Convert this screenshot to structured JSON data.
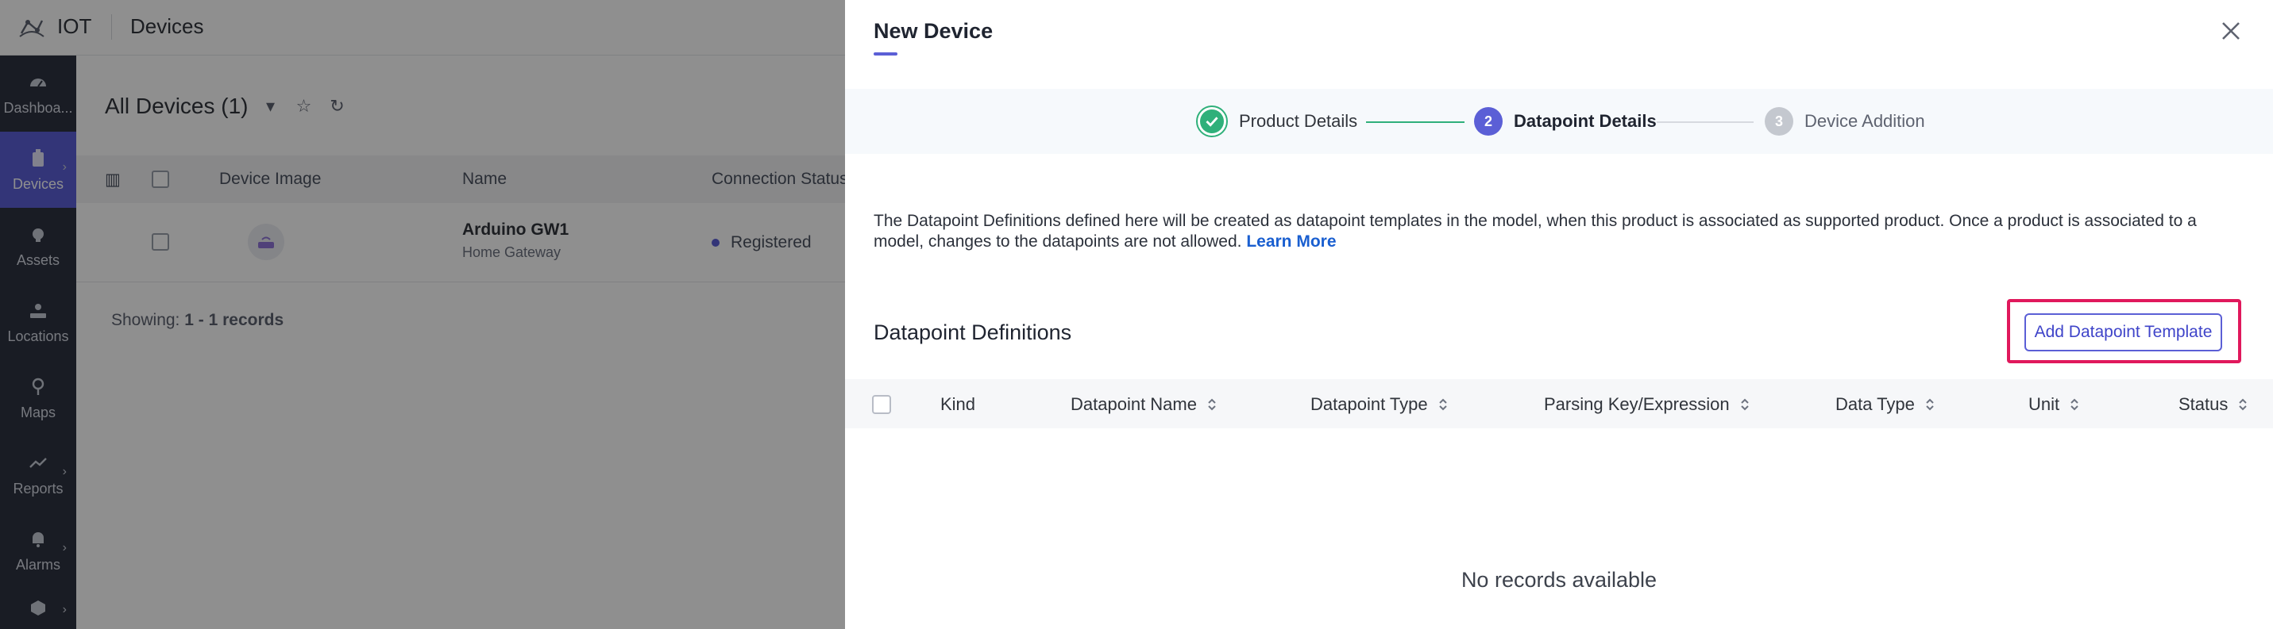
{
  "app": {
    "title": "IOT",
    "breadcrumb": "Devices"
  },
  "sidebar": {
    "items": [
      {
        "label": "Dashboa...",
        "icon": "dashboard-icon",
        "active": false
      },
      {
        "label": "Devices",
        "icon": "device-icon",
        "active": true
      },
      {
        "label": "Assets",
        "icon": "assets-icon",
        "active": false
      },
      {
        "label": "Locations",
        "icon": "location-icon",
        "active": false
      },
      {
        "label": "Maps",
        "icon": "map-pin-icon",
        "active": false
      },
      {
        "label": "Reports",
        "icon": "trend-icon",
        "active": false
      },
      {
        "label": "Alarms",
        "icon": "bell-icon",
        "active": false
      },
      {
        "label": "",
        "icon": "cube-icon",
        "active": false
      }
    ]
  },
  "devices_list": {
    "title": "All Devices (1)",
    "columns": [
      "Device Image",
      "Name",
      "Connection Status"
    ],
    "rows": [
      {
        "name": "Arduino GW1",
        "subtitle": "Home Gateway",
        "status": "Registered"
      }
    ],
    "showing_label": "Showing:",
    "showing_value": "1 - 1 records"
  },
  "drawer": {
    "title": "New Device",
    "steps": [
      {
        "number": "",
        "label": "Product Details",
        "state": "completed"
      },
      {
        "number": "2",
        "label": "Datapoint Details",
        "state": "active"
      },
      {
        "number": "3",
        "label": "Device Addition",
        "state": "pending"
      }
    ],
    "description": "The Datapoint Definitions defined here will be created as datapoint templates in the model, when this product is associated as supported product. Once a product is associated to a model, changes to the datapoints are not allowed.",
    "learn_more": "Learn More",
    "section_title": "Datapoint Definitions",
    "add_button": "Add Datapoint Template",
    "table": {
      "columns": [
        {
          "label": "Kind",
          "sortable": false
        },
        {
          "label": "Datapoint Name",
          "sortable": true
        },
        {
          "label": "Datapoint Type",
          "sortable": true
        },
        {
          "label": "Parsing Key/Expression",
          "sortable": true
        },
        {
          "label": "Data Type",
          "sortable": true
        },
        {
          "label": "Unit",
          "sortable": true
        },
        {
          "label": "Status",
          "sortable": true
        }
      ],
      "empty_text": "No records available"
    }
  },
  "colors": {
    "accent": "#5b5fd6",
    "success": "#2fb07a",
    "highlight": "#e0185c",
    "link": "#1a5fd0",
    "sidebar_bg": "#2d3340"
  }
}
